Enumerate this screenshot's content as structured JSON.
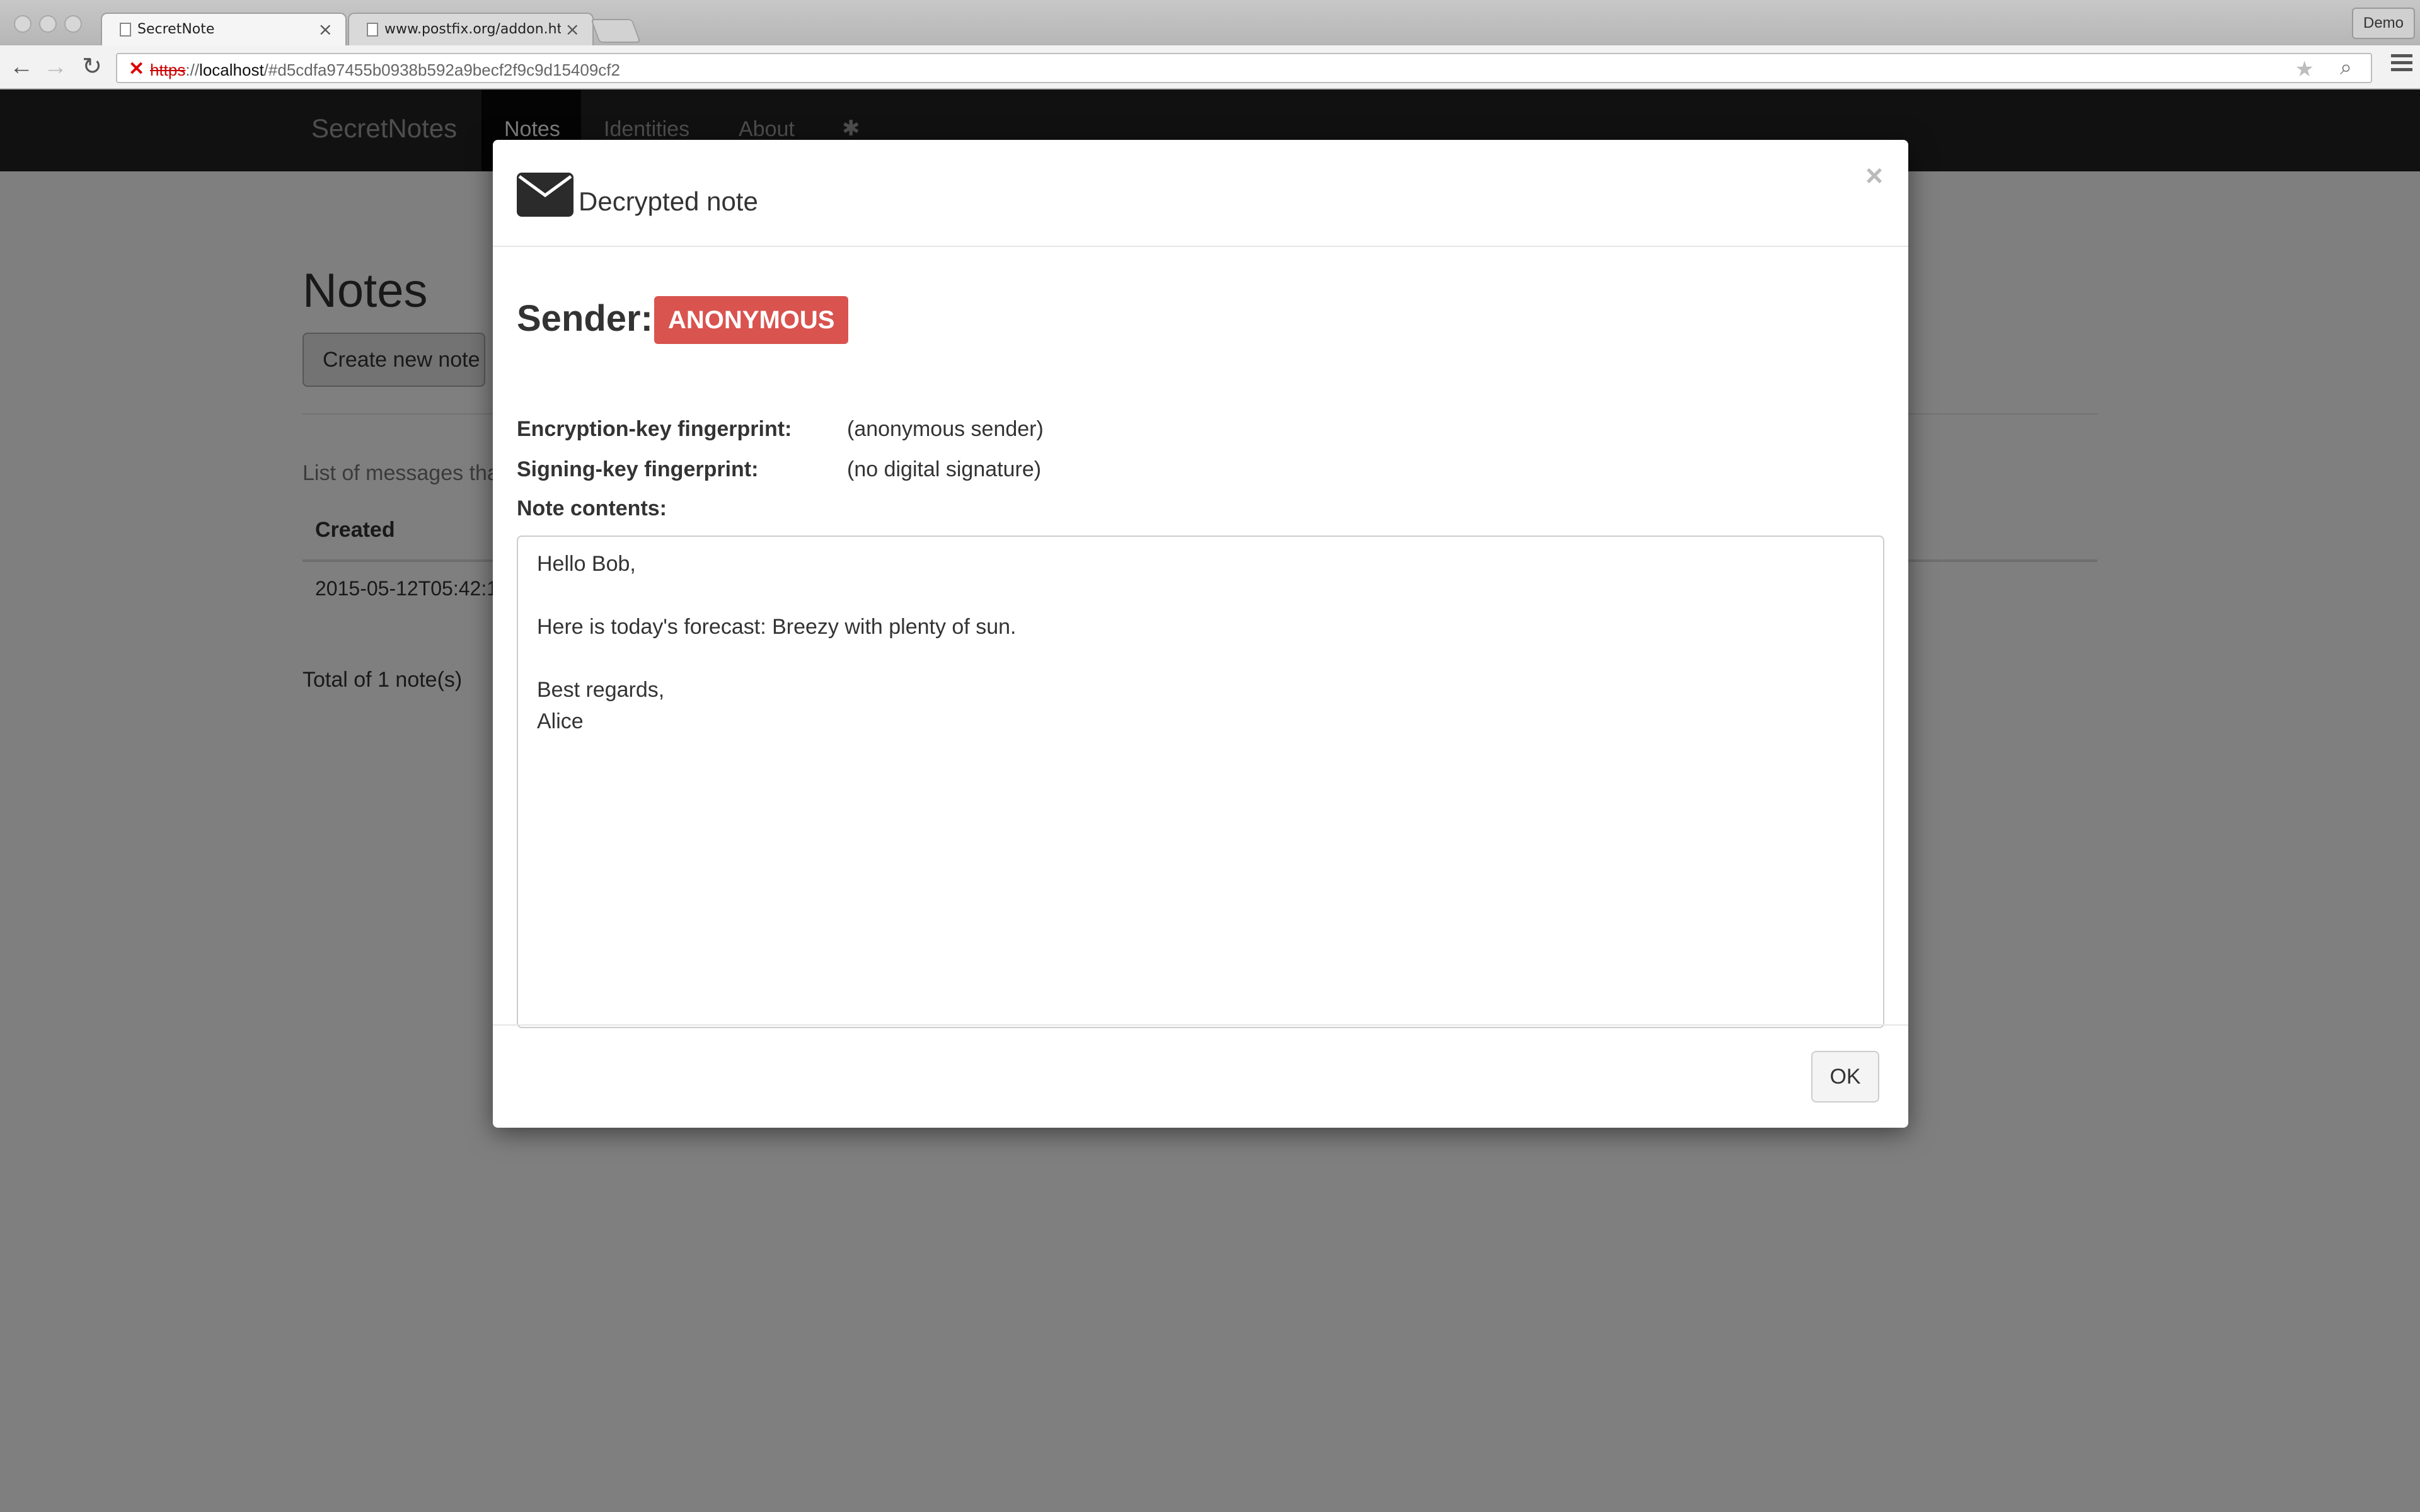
{
  "browser": {
    "tabs": [
      {
        "title": "SecretNote",
        "active": true
      },
      {
        "title": "www.postfix.org/addon.htm",
        "active": false
      }
    ],
    "profile": "Demo",
    "url": {
      "scheme": "https",
      "host": "localhost",
      "rest": "/#d5cdfa97455b0938b592a9becf2f9c9d15409cf2"
    }
  },
  "navbar": {
    "brand": "SecretNotes",
    "links": [
      "Notes",
      "Identities",
      "About"
    ],
    "active": "Notes",
    "extra_icon": "bug-icon"
  },
  "notes_page": {
    "heading": "Notes",
    "create_button": "Create new note",
    "description": "List of messages that",
    "table": {
      "headers": [
        "Created"
      ],
      "rows": [
        [
          "2015-05-12T05:42:1"
        ]
      ]
    },
    "total": "Total of 1 note(s)"
  },
  "modal": {
    "title": "Decrypted note",
    "close_symbol": "×",
    "sender_label": "Sender:",
    "sender_badge": "ANONYMOUS",
    "badge_color": "#d9534f",
    "fields": [
      {
        "label": "Encryption-key fingerprint:",
        "value": "(anonymous sender)"
      },
      {
        "label": "Signing-key fingerprint:",
        "value": "(no digital signature)"
      }
    ],
    "contents_label": "Note contents:",
    "contents": "Hello Bob,\n\nHere is today's forecast: Breezy with plenty of sun.\n\nBest regards,\nAlice",
    "ok_button": "OK"
  }
}
